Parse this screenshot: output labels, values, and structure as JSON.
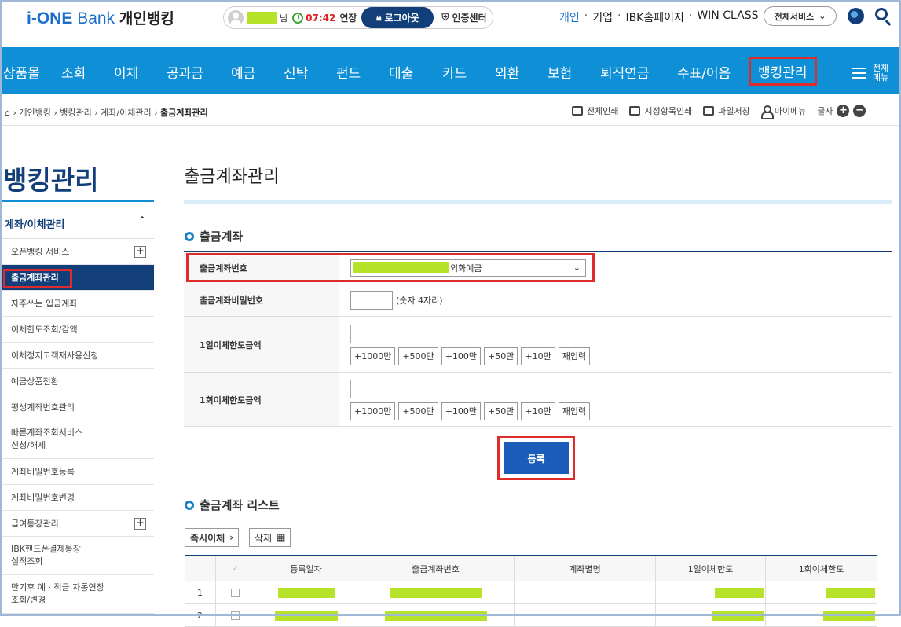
{
  "header": {
    "logo_brand": "i-ONE",
    "logo_bank": "Bank",
    "logo_personal": "개인뱅킹",
    "user_suffix": "님",
    "session_time": "07:42",
    "extend_label": "연장",
    "logout_label": "로그아웃",
    "cert_center_label": "인증센터",
    "top_links": [
      "개인",
      "기업",
      "IBK홈페이지",
      "WIN CLASS"
    ],
    "all_services_label": "전체서비스"
  },
  "nav": {
    "items": [
      "상품몰",
      "조회",
      "이체",
      "공과금",
      "예금",
      "신탁",
      "펀드",
      "대출",
      "카드",
      "외환",
      "보험",
      "퇴직연금",
      "수표/어음",
      "뱅킹관리"
    ],
    "active_item": "뱅킹관리",
    "all_menu_label": "전체\n메뉴"
  },
  "breadcrumb": {
    "items": [
      "개인뱅킹",
      "뱅킹관리",
      "계좌/이체관리"
    ],
    "current": "출금계좌관리"
  },
  "tools": {
    "print_all": "전체인쇄",
    "print_selected": "지정항목인쇄",
    "save_file": "파일저장",
    "my_menu": "마이메뉴",
    "font_size": "글자"
  },
  "sidebar": {
    "title": "뱅킹관리",
    "section": "계좌/이체관리",
    "items": [
      {
        "label": "오픈뱅킹 서비스",
        "expandable": true
      },
      {
        "label": "출금계좌관리",
        "selected": true
      },
      {
        "label": "자주쓰는 입금계좌"
      },
      {
        "label": "이체한도조회/감액"
      },
      {
        "label": "이체정지고객재사용신청"
      },
      {
        "label": "예금상품전환"
      },
      {
        "label": "평생계좌번호관리"
      },
      {
        "label": "빠른계좌조회서비스\n신청/해제"
      },
      {
        "label": "계좌비밀번호등록"
      },
      {
        "label": "계좌비밀번호변경"
      },
      {
        "label": "급여통장관리",
        "expandable": true
      },
      {
        "label": "IBK핸드폰결제통장\n실적조회"
      },
      {
        "label": "만기후 예 · 적금 자동연장\n조회/변경"
      }
    ]
  },
  "main": {
    "page_title": "출금계좌관리",
    "section1_title": "출금계좌",
    "form": {
      "account_label": "출금계좌번호",
      "account_type": "외화예금",
      "password_label": "출금계좌비밀번호",
      "password_hint": "(숫자 4자리)",
      "daily_limit_label": "1일이체한도금액",
      "single_limit_label": "1회이체한도금액",
      "amount_buttons": [
        "+1000만",
        "+500만",
        "+100만",
        "+50만",
        "+10만"
      ],
      "reset_label": "재입력"
    },
    "register_label": "등록",
    "section2_title": "출금계좌 리스트",
    "instant_transfer_label": "즉시이체",
    "delete_label": "삭제",
    "list_columns": [
      "",
      "등록일자",
      "출금계좌번호",
      "계좌별명",
      "1일이체한도",
      "1회이체한도"
    ],
    "list_rows": [
      "1",
      "2"
    ]
  },
  "colors": {
    "nav_bg": "#0e8fd6",
    "brand_navy": "#123f7a",
    "highlight_red": "#e02b2b",
    "mask_green": "#b6e32a",
    "register_blue": "#1a5cb8"
  }
}
